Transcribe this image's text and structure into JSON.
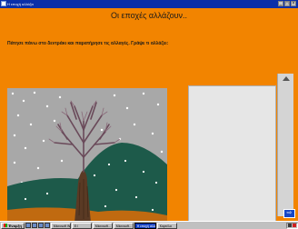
{
  "window": {
    "title": "Η εποχή αλλάζει"
  },
  "heading": "Οι εποχές αλλάζουν..",
  "instruction": "Πάτησε πάνω στο δεντράκι και παρατήρησε τις αλλαγές. Γράψε τι αλλάζει:",
  "picture": {
    "description_icon": "winter-tree-image",
    "season": "winter"
  },
  "colors": {
    "background": "#f28400",
    "titlebar": "#0a2fa8",
    "writing_area": "#e6e6e6"
  },
  "next_button": {
    "symbol": "⇨"
  },
  "taskbar": {
    "start_label": "Έναρξη",
    "quick_icons": [
      "desktop-icon",
      "browser-icon",
      "email-icon",
      "media-icon"
    ],
    "tasks": [
      "Microsoft Wor…",
      "Ε:\\",
      "Microsoft…",
      "Microsoft…",
      "Η εποχή αλλάζει",
      "Καρτέλα"
    ]
  }
}
